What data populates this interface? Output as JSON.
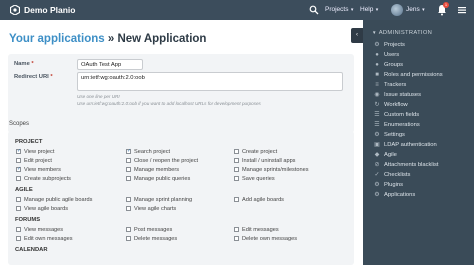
{
  "header": {
    "brand": "Demo Planio",
    "nav": [
      {
        "label": "Projects"
      },
      {
        "label": "Help"
      },
      {
        "label": "Jens"
      }
    ],
    "notifications_count": "1"
  },
  "page": {
    "crumb": "Your applications",
    "separator": " » ",
    "title": "New Application"
  },
  "form": {
    "name_label": "Name",
    "name_value": "OAuth Test App",
    "redirect_label": "Redirect URI",
    "redirect_value": "urn:ietf:wg:oauth:2.0:oob",
    "hint1": "Use one line per URI",
    "hint2": "Use urn:ietf:wg:oauth:2.0:oob if you want to add localhost URLs for development purposes"
  },
  "scopes": {
    "heading": "Scopes",
    "groups": [
      {
        "label": "PROJECT",
        "items": [
          {
            "label": "View project",
            "checked": true
          },
          {
            "label": "Search project",
            "checked": true
          },
          {
            "label": "Create project",
            "checked": false
          },
          {
            "label": "Edit project",
            "checked": false
          },
          {
            "label": "Close / reopen the project",
            "checked": false
          },
          {
            "label": "Install / uninstall apps",
            "checked": false
          },
          {
            "label": "View members",
            "checked": true
          },
          {
            "label": "Manage members",
            "checked": false
          },
          {
            "label": "Manage sprints/milestones",
            "checked": false
          },
          {
            "label": "Create subprojects",
            "checked": false
          },
          {
            "label": "Manage public queries",
            "checked": false
          },
          {
            "label": "Save queries",
            "checked": false
          }
        ]
      },
      {
        "label": "AGILE",
        "items": [
          {
            "label": "Manage public agile boards",
            "checked": false
          },
          {
            "label": "Manage sprint planning",
            "checked": false
          },
          {
            "label": "Add agile boards",
            "checked": false
          },
          {
            "label": "View agile boards",
            "checked": false
          },
          {
            "label": "View agile charts",
            "checked": false
          }
        ]
      },
      {
        "label": "FORUMS",
        "items": [
          {
            "label": "View messages",
            "checked": false
          },
          {
            "label": "Post messages",
            "checked": false
          },
          {
            "label": "Edit messages",
            "checked": false
          },
          {
            "label": "Edit own messages",
            "checked": false
          },
          {
            "label": "Delete messages",
            "checked": false
          },
          {
            "label": "Delete own messages",
            "checked": false
          }
        ]
      },
      {
        "label": "CALENDAR",
        "items": []
      }
    ]
  },
  "sidebar": {
    "title": "ADMINISTRATION",
    "items": [
      {
        "label": "Projects",
        "icon": "projects-icon"
      },
      {
        "label": "Users",
        "icon": "users-icon"
      },
      {
        "label": "Groups",
        "icon": "groups-icon"
      },
      {
        "label": "Roles and permissions",
        "icon": "roles-icon"
      },
      {
        "label": "Trackers",
        "icon": "trackers-icon"
      },
      {
        "label": "Issue statuses",
        "icon": "issue-statuses-icon"
      },
      {
        "label": "Workflow",
        "icon": "workflow-icon"
      },
      {
        "label": "Custom fields",
        "icon": "custom-fields-icon"
      },
      {
        "label": "Enumerations",
        "icon": "enumerations-icon"
      },
      {
        "label": "Settings",
        "icon": "settings-icon"
      },
      {
        "label": "LDAP authentication",
        "icon": "ldap-icon"
      },
      {
        "label": "Agile",
        "icon": "agile-icon"
      },
      {
        "label": "Attachments blacklist",
        "icon": "attachments-icon"
      },
      {
        "label": "Checklists",
        "icon": "checklists-icon"
      },
      {
        "label": "Plugins",
        "icon": "plugins-icon"
      },
      {
        "label": "Applications",
        "icon": "applications-icon"
      }
    ]
  },
  "colors": {
    "topbar": "#3c4d5c",
    "sidebar": "#3a4b58",
    "link": "#3d8fc6",
    "panel": "#f2f4f6",
    "badge": "#e74c3c"
  }
}
